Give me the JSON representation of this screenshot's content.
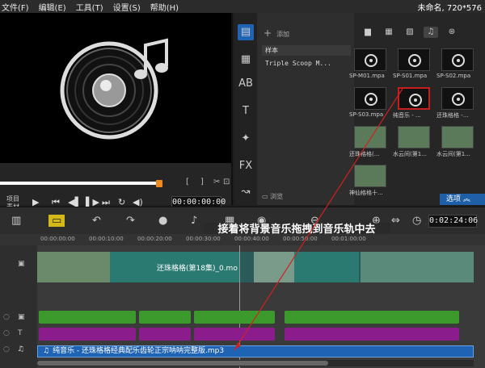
{
  "menu": {
    "items": [
      "文件(F)",
      "编辑(E)",
      "工具(T)",
      "设置(S)",
      "帮助(H)"
    ],
    "project": "未命名, 720*576"
  },
  "preview": {
    "project_label": "项目",
    "clip_label": "素材",
    "timecode": "00:00:00:00"
  },
  "library": {
    "add_label": "添加",
    "folders": [
      "样本",
      "Triple Scoop M..."
    ],
    "browse_label": "浏览",
    "options_label": "选项",
    "thumbs": [
      {
        "name": "SP-M01.mpa",
        "type": "audio"
      },
      {
        "name": "SP-S01.mpa",
        "type": "audio"
      },
      {
        "name": "SP-S02.mpa",
        "type": "audio"
      },
      {
        "name": "SP-S03.mpa",
        "type": "audio"
      },
      {
        "name": "纯音乐 - ...",
        "type": "audio",
        "selected": true
      },
      {
        "name": "还珠格格 -...",
        "type": "audio"
      },
      {
        "name": "还珠格格(...",
        "type": "video"
      },
      {
        "name": "水云间(第1...",
        "type": "video"
      },
      {
        "name": "水云间(第1...",
        "type": "video"
      },
      {
        "name": "神仙格格十...",
        "type": "video"
      }
    ]
  },
  "toolbar": {
    "timecode": "0:02:24:06"
  },
  "timeline": {
    "ruler": [
      "00:00:00:00",
      "00:00:10:00",
      "00:00:20:00",
      "00:00:30:00",
      "00:00:40:00",
      "00:00:50:00",
      "00:01:00:00"
    ],
    "video_title": "还珠格格(第18集)_0.mo",
    "music_label": "纯音乐 - 还珠格格经典配乐齿轮正宗呐呐完整版.mp3"
  },
  "annotation": "接着将背景音乐拖拽到音乐轨中去",
  "colors": {
    "accent": "#1f63b4",
    "highlight": "#c81e1e",
    "title_track": "#3c9a2c",
    "voice_track": "#8a1c8c"
  }
}
